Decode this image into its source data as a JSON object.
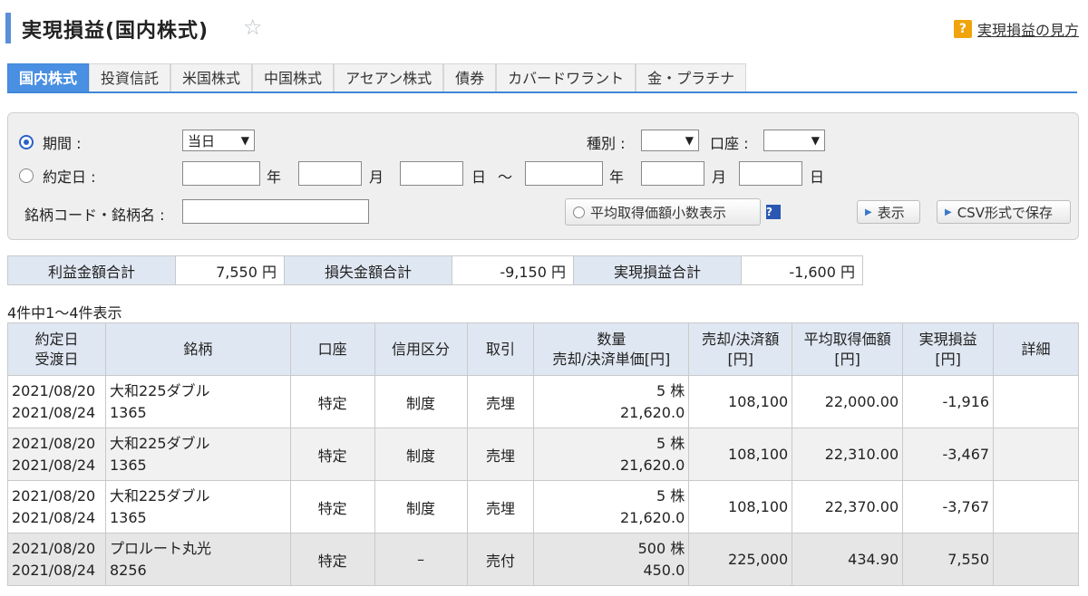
{
  "header": {
    "title": "実現損益(国内株式)",
    "help_label": "実現損益の見方",
    "help_icon": "?"
  },
  "tabs": [
    {
      "label": "国内株式",
      "active": true
    },
    {
      "label": "投資信託"
    },
    {
      "label": "米国株式"
    },
    {
      "label": "中国株式"
    },
    {
      "label": "アセアン株式"
    },
    {
      "label": "債券"
    },
    {
      "label": "カバードワラント"
    },
    {
      "label": "金・プラチナ"
    }
  ],
  "filter": {
    "period_label": "期間 :",
    "period_value": "当日",
    "contract_date_label": "約定日 :",
    "year": "年",
    "month": "月",
    "day": "日",
    "range_sep": "〜",
    "type_label": "種別 :",
    "account_label": "口座 :",
    "code_label": "銘柄コード・銘柄名 :",
    "decimal_toggle_label": "平均取得価額小数表示",
    "show_button": "表示",
    "csv_button": "CSV形式で保存"
  },
  "summary": {
    "profit_label": "利益金額合計",
    "profit_value": "7,550 円",
    "loss_label": "損失金額合計",
    "loss_value": "-9,150 円",
    "realized_label": "実現損益合計",
    "realized_value": "-1,600 円"
  },
  "count_text": "4件中1〜4件表示",
  "table": {
    "headers": {
      "date1": "約定日",
      "date2": "受渡日",
      "name": "銘柄",
      "account": "口座",
      "margin": "信用区分",
      "trade": "取引",
      "qty1": "数量",
      "qty2": "売却/決済単価[円]",
      "sale1": "売却/決済額",
      "sale2": "[円]",
      "avg1": "平均取得価額",
      "avg2": "[円]",
      "pl1": "実現損益",
      "pl2": "[円]",
      "detail": "詳細"
    },
    "rows": [
      {
        "contract": "2021/08/20",
        "delivery": "2021/08/24",
        "name": "大和225ダブル",
        "code": "1365",
        "account": "特定",
        "margin": "制度",
        "trade": "売埋",
        "qty": "5 株",
        "price": "21,620.0",
        "amount": "108,100",
        "avg": "22,000.00",
        "pl": "-1,916"
      },
      {
        "contract": "2021/08/20",
        "delivery": "2021/08/24",
        "name": "大和225ダブル",
        "code": "1365",
        "account": "特定",
        "margin": "制度",
        "trade": "売埋",
        "qty": "5 株",
        "price": "21,620.0",
        "amount": "108,100",
        "avg": "22,310.00",
        "pl": "-3,467"
      },
      {
        "contract": "2021/08/20",
        "delivery": "2021/08/24",
        "name": "大和225ダブル",
        "code": "1365",
        "account": "特定",
        "margin": "制度",
        "trade": "売埋",
        "qty": "5 株",
        "price": "21,620.0",
        "amount": "108,100",
        "avg": "22,370.00",
        "pl": "-3,767"
      },
      {
        "contract": "2021/08/20",
        "delivery": "2021/08/24",
        "name": "プロルート丸光",
        "code": "8256",
        "account": "特定",
        "margin": "–",
        "trade": "売付",
        "qty": "500 株",
        "price": "450.0",
        "amount": "225,000",
        "avg": "434.90",
        "pl": "7,550"
      }
    ]
  }
}
